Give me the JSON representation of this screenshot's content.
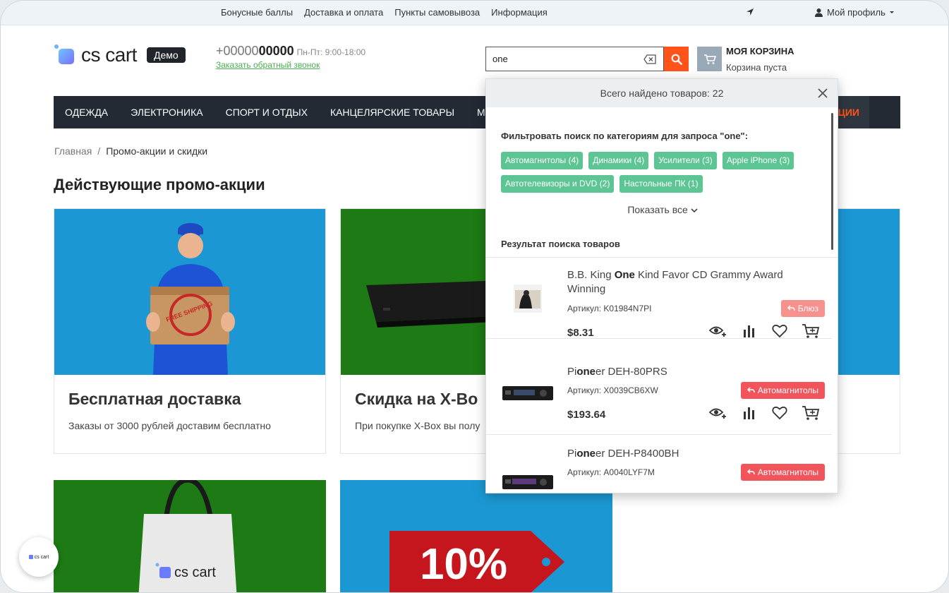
{
  "topbar": {
    "links": [
      "Бонусные баллы",
      "Доставка и оплата",
      "Пункты самовывоза",
      "Информация"
    ],
    "profile_label": "Мой профиль"
  },
  "header": {
    "logo_text": "cs cart",
    "demo_label": "Демо",
    "phone_prefix": "+00000",
    "phone_bold": "00000",
    "hours": "Пн-Пт: 9:00-18:00",
    "callback_link": "Заказать обратный звонок",
    "search_value": "one",
    "cart_title": "МОЯ КОРЗИНА",
    "cart_status": "Корзина пуста"
  },
  "nav": {
    "items": [
      "ОДЕЖДА",
      "ЭЛЕКТРОНИКА",
      "СПОРТ И ОТДЫХ",
      "КАНЦЕЛЯРСКИЕ ТОВАРЫ",
      "МУЛЬТ"
    ],
    "promo_tail": "ЦИИ"
  },
  "breadcrumb": {
    "home": "Главная",
    "sep": "/",
    "current": "Промо-акции и скидки"
  },
  "page_title": "Действующие промо-акции",
  "promos": [
    {
      "title": "Бесплатная доставка",
      "desc": "Заказы от 3000 рублей доставим бесплатно",
      "stamp": "FREE SHIPPING"
    },
    {
      "title": "Скидка на X-Bo",
      "desc": "При покупке X-Box вы полу"
    },
    {
      "title": "",
      "desc": "",
      "logo_text": "cs cart"
    },
    {
      "title": "",
      "desc": "",
      "big_text": "10%"
    }
  ],
  "float_logo_text": "cs cart",
  "search_dropdown": {
    "header": "Всего найдено товаров: 22",
    "filter_title": "Фильтровать поиск по категориям для запроса \"one\":",
    "chips": [
      "Автомагнитолы (4)",
      "Динамики (4)",
      "Усилители (3)",
      "Apple iPhone (3)",
      "Автотелевизоры и DVD (2)",
      "Настольные ПК (1)"
    ],
    "show_all": "Показать все",
    "results_title": "Результат поиска товаров",
    "items": [
      {
        "name_pre": "B.B. King ",
        "name_hl": "One",
        "name_post": " Kind Favor CD Grammy Award Winning",
        "sku": "Артикул: K01984N7PI",
        "tag": "Блюз",
        "tag_color": "#f7918e",
        "price": "$8.31"
      },
      {
        "name_pre": "Pi",
        "name_hl": "one",
        "name_post": "er DEH-80PRS",
        "sku": "Артикул: X0039CB6XW",
        "tag": "Автомагнитолы",
        "tag_color": "#f2545b",
        "price": "$193.64"
      },
      {
        "name_pre": "Pi",
        "name_hl": "one",
        "name_post": "er DEH-P8400BH",
        "sku": "Артикул: A0040LYF7M",
        "tag": "Автомагнитолы",
        "tag_color": "#f2545b",
        "price": ""
      }
    ],
    "action_icons": [
      "quick-view-icon",
      "compare-icon",
      "wishlist-icon",
      "add-to-cart-icon"
    ]
  },
  "colors": {
    "accent": "#ff5319",
    "nav_bg": "#232a33",
    "chip": "#5cc593",
    "promo_blue": "#1b98d3",
    "promo_green": "#1d7a14"
  }
}
